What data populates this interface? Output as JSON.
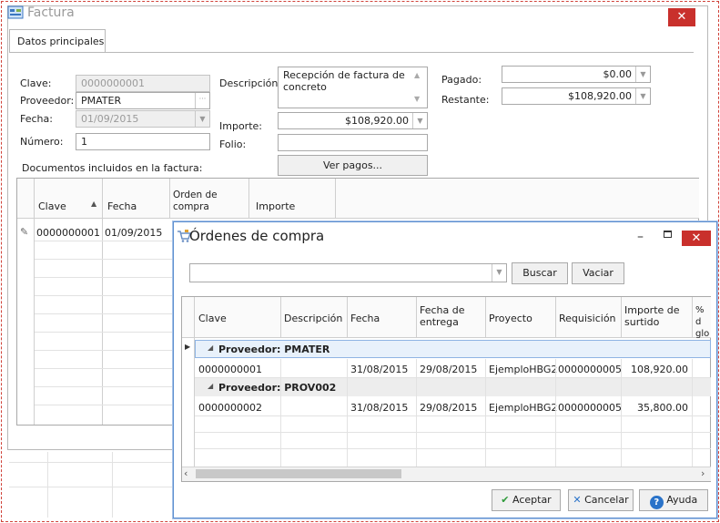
{
  "factura": {
    "title": "Factura",
    "close": "✕",
    "tab": "Datos principales",
    "labels": {
      "clave": "Clave:",
      "proveedor": "Proveedor:",
      "fecha": "Fecha:",
      "numero": "Número:",
      "descripcion": "Descripción:",
      "importe": "Importe:",
      "folio": "Folio:",
      "pagado": "Pagado:",
      "restante": "Restante:",
      "documentos": "Documentos incluidos en la factura:"
    },
    "values": {
      "clave": "0000000001",
      "proveedor": "PMATER",
      "fecha": "01/09/2015",
      "numero": "1",
      "descripcion": "Recepción de factura de concreto",
      "importe": "$108,920.00",
      "folio": "",
      "pagado": "$0.00",
      "restante": "$108,920.00"
    },
    "ver_pagos": "Ver pagos...",
    "grid": {
      "headers": [
        "Clave",
        "Fecha",
        "Orden de compra",
        "Importe"
      ],
      "rows": [
        {
          "clave": "0000000001",
          "fecha": "01/09/2015"
        }
      ]
    }
  },
  "ordenes": {
    "title": "Órdenes de compra",
    "close": "✕",
    "minimize": "–",
    "search_value": "",
    "buscar": "Buscar",
    "vaciar": "Vaciar",
    "columns": [
      "Clave",
      "Descripción",
      "Fecha",
      "Fecha de entrega",
      "Proyecto",
      "Requisición",
      "Importe de surtido",
      "% d glob"
    ],
    "groups": [
      {
        "label": "Proveedor: PMATER",
        "rows": [
          {
            "clave": "0000000001",
            "descripcion": "",
            "fecha": "31/08/2015",
            "entrega": "29/08/2015",
            "proyecto": "EjemploHBG2",
            "requisicion": "0000000005",
            "importe": "108,920.00"
          }
        ]
      },
      {
        "label": "Proveedor: PROV002",
        "rows": [
          {
            "clave": "0000000002",
            "descripcion": "",
            "fecha": "31/08/2015",
            "entrega": "29/08/2015",
            "proyecto": "EjemploHBG2",
            "requisicion": "0000000005",
            "importe": "35,800.00"
          }
        ]
      }
    ],
    "buttons": {
      "aceptar": "Aceptar",
      "cancelar": "Cancelar",
      "ayuda": "Ayuda"
    },
    "colors": {
      "accent": "#2a73c9",
      "close": "#c9302c",
      "ok": "#2e9a3a"
    }
  }
}
